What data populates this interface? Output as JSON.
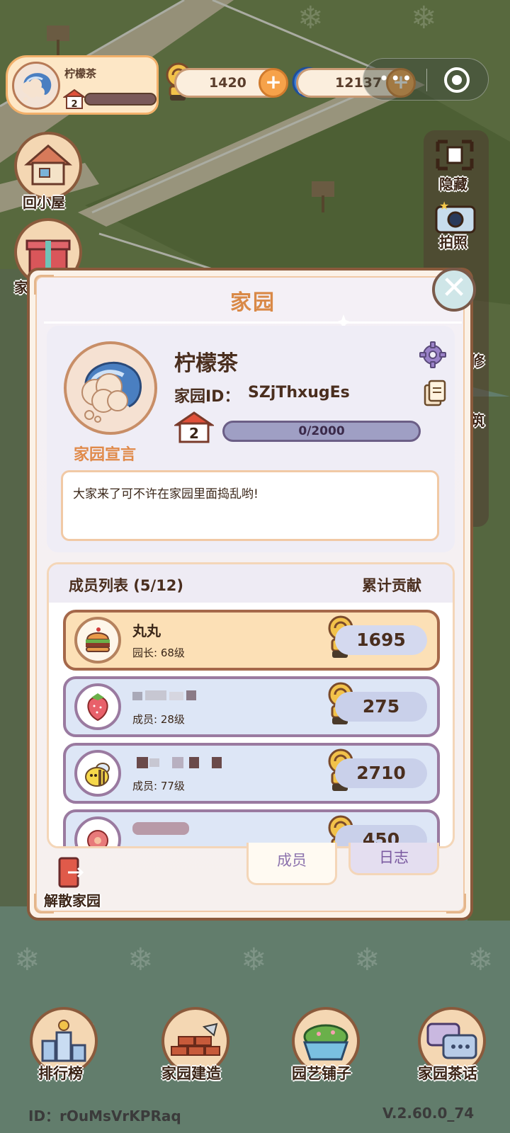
{
  "hud": {
    "player_name": "柠檬茶",
    "player_level": "2",
    "coins": "1420",
    "swirl": "12137",
    "plus": "+",
    "capsule_menu": "•••"
  },
  "left_buttons": {
    "home": "回小屋",
    "gift": "家"
  },
  "right_buttons": {
    "hide": "隐藏",
    "photo": "拍照",
    "repair": "修",
    "build": "筑"
  },
  "dialog": {
    "title": "家园",
    "close": "✕",
    "home_name": "柠檬茶",
    "home_id_label": "家园ID：",
    "home_id": "SZjThxugEs",
    "level": "2",
    "exp": "0/2000",
    "exp_fraction": 0.0,
    "motto_button": "家园宣言",
    "motto": "大家来了可不许在家园里面捣乱哟!",
    "members_title": "成员列表 (5/12)",
    "contrib_title": "累计贡献",
    "members": [
      {
        "name": "丸丸",
        "rank": "园长: 68级",
        "contribution": "1695",
        "avatar": "burger-avatar"
      },
      {
        "name": "",
        "rank": "成员: 28级",
        "contribution": "275",
        "avatar": "strawberry-avatar"
      },
      {
        "name": "",
        "rank": "成员: 77级",
        "contribution": "2710",
        "avatar": "bee-avatar"
      },
      {
        "name": "",
        "rank": "",
        "contribution": "450",
        "avatar": "flower-avatar"
      }
    ],
    "tabs": {
      "members": "成员",
      "log": "日志"
    },
    "dissolve": "解散家园"
  },
  "nav": {
    "ranking": "排行榜",
    "build": "家园建造",
    "shop": "园艺铺子",
    "chat": "家园茶话"
  },
  "footer": {
    "id": "ID：rOuMsVrKPRaq",
    "version": "V.2.60.0_74"
  },
  "colors": {
    "accent_orange": "#d98947",
    "dialog_border": "#8a5a3c",
    "leader_row": "#fce0b6",
    "member_row": "#dde6f6"
  }
}
